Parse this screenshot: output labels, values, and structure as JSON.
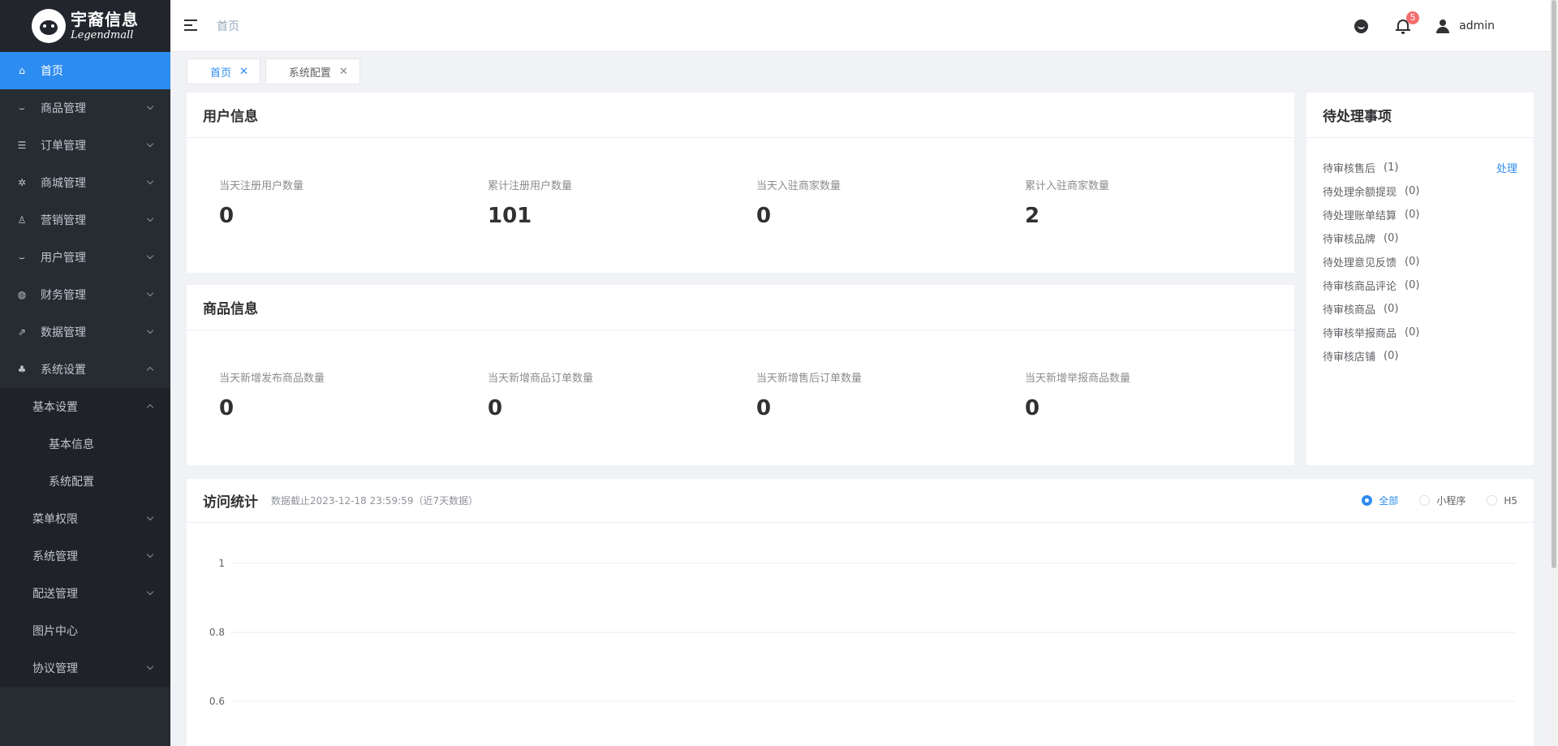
{
  "logo": {
    "cn": "宇裔信息",
    "en": "Legendmall"
  },
  "header": {
    "breadcrumb": "首页",
    "badge_count": "5",
    "username": "admin"
  },
  "sidebar": {
    "items": [
      {
        "label": "首页",
        "icon": "home-icon"
      },
      {
        "label": "商品管理",
        "icon": "eye-closed-icon"
      },
      {
        "label": "订单管理",
        "icon": "list-icon"
      },
      {
        "label": "商城管理",
        "icon": "gear-icon"
      },
      {
        "label": "营销管理",
        "icon": "person-icon"
      },
      {
        "label": "用户管理",
        "icon": "eye-closed-icon"
      },
      {
        "label": "财务管理",
        "icon": "finance-icon"
      },
      {
        "label": "数据管理",
        "icon": "external-link-icon"
      },
      {
        "label": "系统设置",
        "icon": "org-chart-icon"
      }
    ],
    "sub": {
      "basic": "基本设置",
      "basic_info": "基本信息",
      "sys_config": "系统配置",
      "menu_perm": "菜单权限",
      "sys_manage": "系统管理",
      "delivery": "配送管理",
      "images": "图片中心",
      "protocol": "协议管理"
    }
  },
  "tabs": [
    {
      "label": "首页"
    },
    {
      "label": "系统配置"
    }
  ],
  "user_info": {
    "title": "用户信息",
    "stats": [
      {
        "label": "当天注册用户数量",
        "value": "0"
      },
      {
        "label": "累计注册用户数量",
        "value": "101"
      },
      {
        "label": "当天入驻商家数量",
        "value": "0"
      },
      {
        "label": "累计入驻商家数量",
        "value": "2"
      }
    ]
  },
  "goods_info": {
    "title": "商品信息",
    "stats": [
      {
        "label": "当天新增发布商品数量",
        "value": "0"
      },
      {
        "label": "当天新增商品订单数量",
        "value": "0"
      },
      {
        "label": "当天新增售后订单数量",
        "value": "0"
      },
      {
        "label": "当天新增举报商品数量",
        "value": "0"
      }
    ]
  },
  "todo": {
    "title": "待处理事项",
    "handle_label": "处理",
    "items": [
      {
        "label": "待审核售后",
        "count": "(1)"
      },
      {
        "label": "待处理余额提现",
        "count": "(0)"
      },
      {
        "label": "待处理账单结算",
        "count": "(0)"
      },
      {
        "label": "待审核品牌",
        "count": "(0)"
      },
      {
        "label": "待处理意见反馈",
        "count": "(0)"
      },
      {
        "label": "待审核商品评论",
        "count": "(0)"
      },
      {
        "label": "待审核商品",
        "count": "(0)"
      },
      {
        "label": "待审核举报商品",
        "count": "(0)"
      },
      {
        "label": "待审核店铺",
        "count": "(0)"
      }
    ]
  },
  "visit": {
    "title": "访问统计",
    "subtitle": "数据截止2023-12-18 23:59:59（近7天数据）",
    "filters": [
      {
        "label": "全部",
        "selected": true
      },
      {
        "label": "小程序",
        "selected": false
      },
      {
        "label": "H5",
        "selected": false
      }
    ]
  },
  "chart_data": {
    "type": "line",
    "y_tick_labels": [
      "1",
      "0.8",
      "0.6"
    ],
    "series": [],
    "grid": true
  }
}
